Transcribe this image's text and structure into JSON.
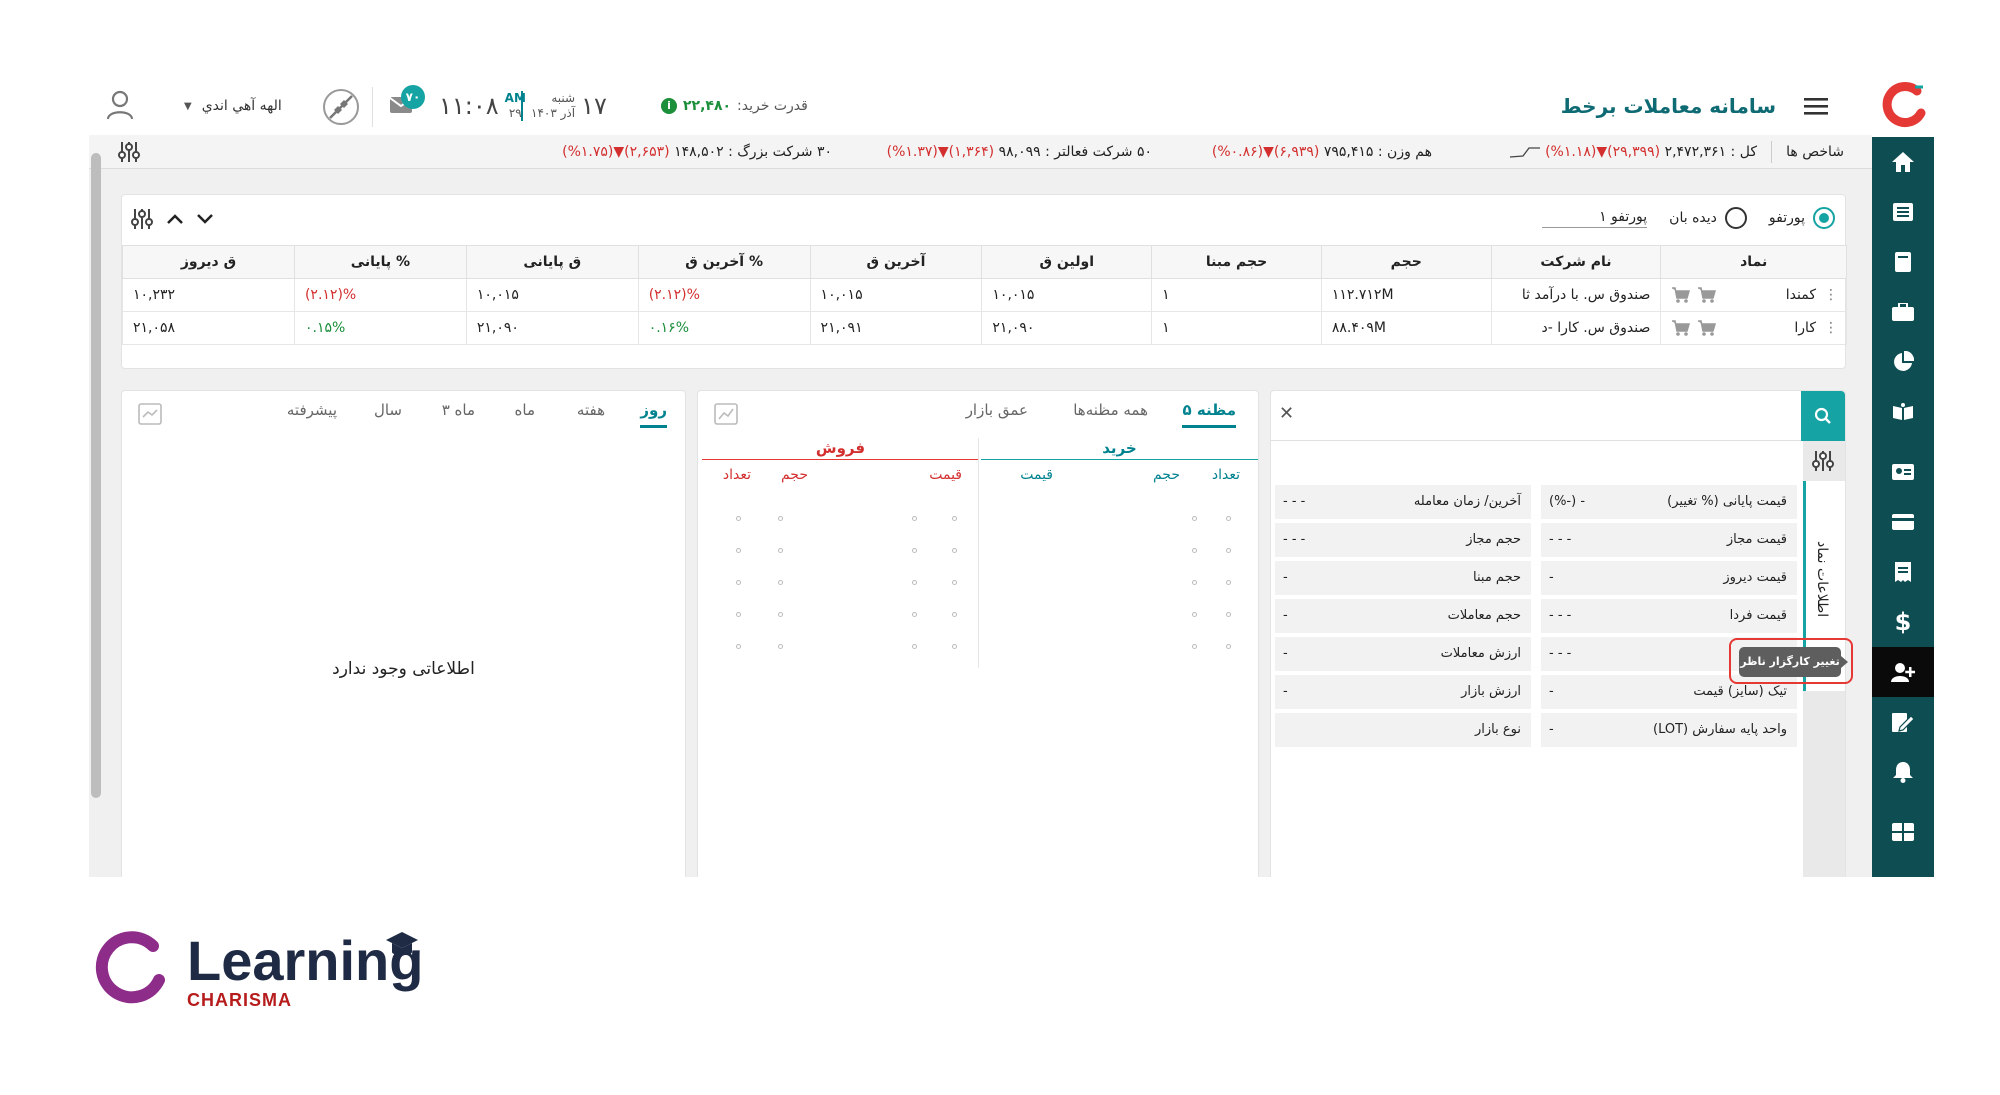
{
  "app": {
    "title": "سامانه معاملات برخط"
  },
  "header": {
    "buying_power_label": "قدرت خرید:",
    "buying_power_value": "۲۲,۴۸۰",
    "day_num": "۱۷",
    "weekday": "شنبه",
    "month_year": "آذر ۱۴۰۳",
    "ampm": "AM",
    "seconds": "۲۹",
    "time": "۱۱:۰۸",
    "messages_badge": "۷۰",
    "user_name": "الهه آهي اندي"
  },
  "ticker": {
    "index_title": "شاخص ها",
    "total": "کل : ۲,۴۷۲,۳۶۱",
    "total_change": "(۲۹,۳۹۹)",
    "total_pct": "(۱.۱۸%)",
    "equal_weight": "هم وزن : ۷۹۵,۴۱۵",
    "equal_change": "(۶,۹۳۹)",
    "equal_pct": "(۰.۸۶%)",
    "active50": "۵۰ شرکت فعالتر : ۹۸,۰۹۹",
    "active50_change": "(۱,۳۶۴)",
    "active50_pct": "(۱.۳۷%)",
    "big30": "۳۰ شرکت بزرگ : ۱۴۸,۵۰۲",
    "big30_change": "(۲,۶۵۳)",
    "big30_pct": "(۱.۷۵%)"
  },
  "portfolio": {
    "radio_portfolio": "پورتفو",
    "radio_watch": "دیده بان",
    "selected_name": "پورتفو ۱",
    "columns": [
      "نماد",
      "نام شرکت",
      "حجم",
      "حجم مبنا",
      "اولین ق",
      "آخرین ق",
      "% آخرین ق",
      "ق پایانی",
      "% پایانی",
      "ق دیروز"
    ],
    "rows": [
      {
        "symbol": "کمندا",
        "company": "صندوق س. با درآمد ثا",
        "volume": "۱۱۲.۷۱۲M",
        "base_volume": "۱",
        "first": "۱۰,۰۱۵",
        "last": "۱۰,۰۱۵",
        "last_pct": "(۲.۱۲)%",
        "close": "۱۰,۰۱۵",
        "close_pct": "(۲.۱۲)%",
        "prev": "۱۰,۲۳۲"
      },
      {
        "symbol": "کارا",
        "company": "صندوق س. کارا -د",
        "volume": "۸۸.۴۰۹M",
        "base_volume": "۱",
        "first": "۲۱,۰۹۰",
        "last": "۲۱,۰۹۱",
        "last_pct": "۰.۱۶%",
        "close": "۲۱,۰۹۰",
        "close_pct": "۰.۱۵%",
        "prev": "۲۱,۰۵۸"
      }
    ]
  },
  "symbol_info": {
    "vertical_tab": "اطلاعات نماد",
    "left_rows": [
      {
        "label": "آخرین/ زمان معامله",
        "value": "- - -"
      },
      {
        "label": "حجم مجاز",
        "value": "- - -"
      },
      {
        "label": "حجم مبنا",
        "value": "-"
      },
      {
        "label": "حجم معاملات",
        "value": "-"
      },
      {
        "label": "ارزش معاملات",
        "value": "-"
      },
      {
        "label": "ارزش بازار",
        "value": "-"
      },
      {
        "label": "نوع بازار",
        "value": ""
      }
    ],
    "right_rows": [
      {
        "label": "قیمت پایانی (% تغییر)",
        "value": "- (-%)"
      },
      {
        "label": "قیمت مجاز",
        "value": "- - -"
      },
      {
        "label": "قیمت دیروز",
        "value": "-"
      },
      {
        "label": "قیمت فردا",
        "value": "- - -"
      },
      {
        "label": "",
        "value": "- - -"
      },
      {
        "label": "تیک (سایز) قیمت",
        "value": "-"
      },
      {
        "label": "واحد پایه سفارش (LOT)",
        "value": "-"
      }
    ],
    "tooltip": "تغییر کارگزار ناظر"
  },
  "order_book": {
    "tabs": [
      "۵ مظنه",
      "همه مظنه‌ها",
      "عمق بازار"
    ],
    "buy_title": "خرید",
    "sell_title": "فروش",
    "buy_cols": [
      "تعداد",
      "حجم",
      "قیمت"
    ],
    "sell_cols": [
      "قیمت",
      "حجم",
      "تعداد"
    ]
  },
  "chart_panel": {
    "tabs": [
      "روز",
      "هفته",
      "ماه",
      "۳ ماه",
      "سال",
      "پیشرفته"
    ],
    "empty_message": "اطلاعاتی وجود ندارد"
  },
  "brand": {
    "name": "Learning",
    "sub": "CHARISMA"
  },
  "colors": {
    "sidebar": "#0e4d52",
    "accent": "#00838f",
    "negative": "#d32f2f",
    "positive": "#1b8f3a"
  }
}
